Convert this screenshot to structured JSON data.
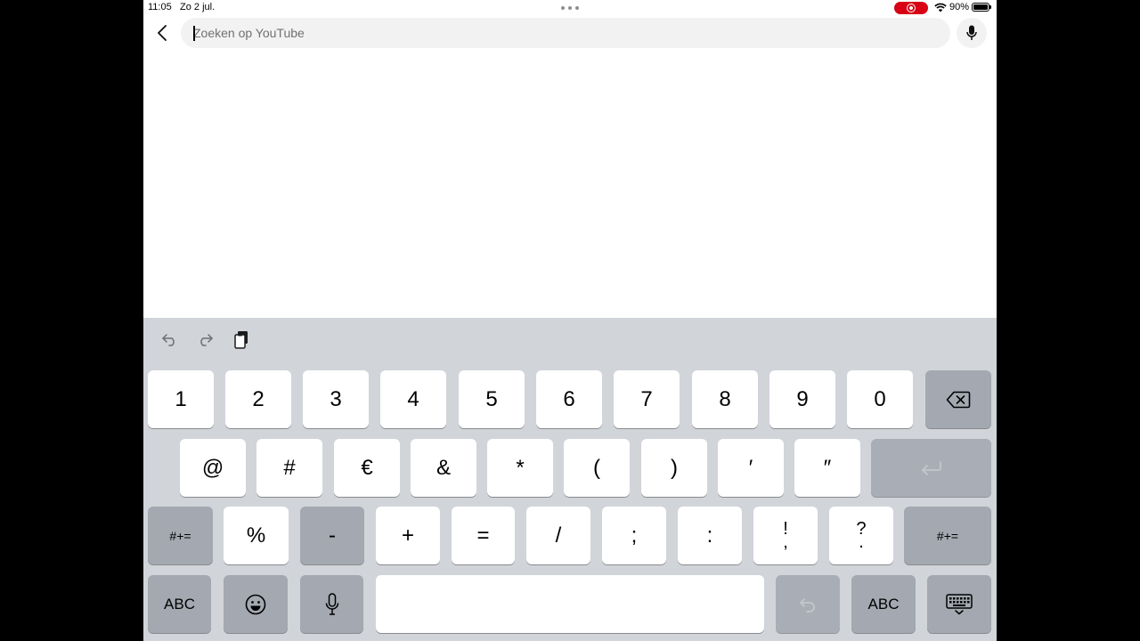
{
  "status_bar": {
    "time": "11:05",
    "date": "Zo 2 jul.",
    "battery": "90%",
    "battery_level": 0.9,
    "recording_color": "#d70015"
  },
  "search": {
    "placeholder": "Zoeken op YouTube",
    "value": "",
    "back_icon": "chevron-left-icon",
    "mic_icon": "microphone-icon"
  },
  "keyboard": {
    "toolbar": [
      "undo-icon",
      "redo-icon",
      "paste-icon"
    ],
    "row1": [
      "1",
      "2",
      "3",
      "4",
      "5",
      "6",
      "7",
      "8",
      "9",
      "0"
    ],
    "row2": [
      "@",
      "#",
      "€",
      "&",
      "*",
      "(",
      ")",
      "′",
      "″"
    ],
    "row3": {
      "left_mode": "#+=",
      "keys": [
        "%",
        "-",
        "+",
        "=",
        "/",
        ";",
        ":"
      ],
      "stacked1": [
        "!",
        ","
      ],
      "stacked2": [
        "?",
        "."
      ],
      "right_mode": "#+="
    },
    "row4": {
      "abc_left": "ABC",
      "emoji_icon": "emoji-icon",
      "dictation_icon": "microphone-icon",
      "undo_icon": "undo-icon",
      "abc_right": "ABC",
      "hide_icon": "keyboard-hide-icon"
    },
    "backspace_icon": "backspace-icon",
    "return_icon": "return-icon"
  }
}
